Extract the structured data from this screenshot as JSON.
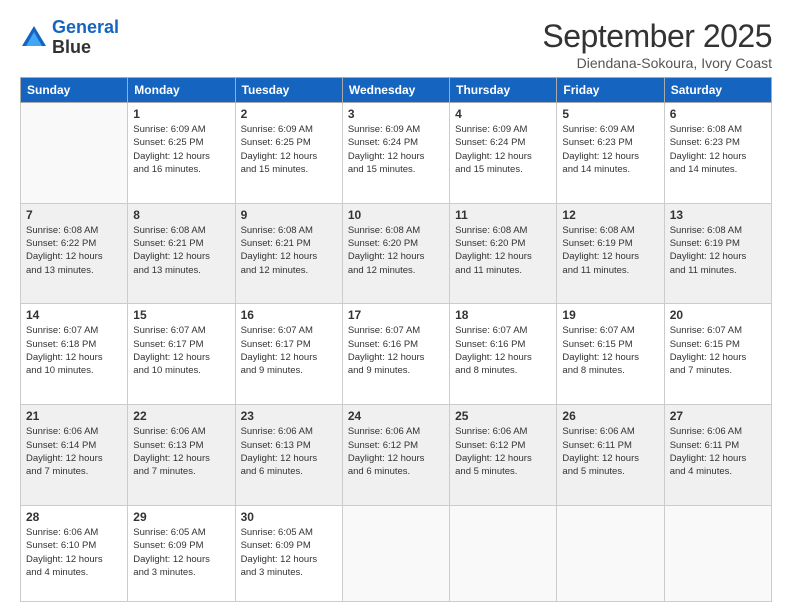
{
  "logo": {
    "line1": "General",
    "line2": "Blue"
  },
  "title": "September 2025",
  "subtitle": "Diendana-Sokoura, Ivory Coast",
  "header_days": [
    "Sunday",
    "Monday",
    "Tuesday",
    "Wednesday",
    "Thursday",
    "Friday",
    "Saturday"
  ],
  "weeks": [
    {
      "shaded": false,
      "days": [
        {
          "num": "",
          "info": ""
        },
        {
          "num": "1",
          "info": "Sunrise: 6:09 AM\nSunset: 6:25 PM\nDaylight: 12 hours\nand 16 minutes."
        },
        {
          "num": "2",
          "info": "Sunrise: 6:09 AM\nSunset: 6:25 PM\nDaylight: 12 hours\nand 15 minutes."
        },
        {
          "num": "3",
          "info": "Sunrise: 6:09 AM\nSunset: 6:24 PM\nDaylight: 12 hours\nand 15 minutes."
        },
        {
          "num": "4",
          "info": "Sunrise: 6:09 AM\nSunset: 6:24 PM\nDaylight: 12 hours\nand 15 minutes."
        },
        {
          "num": "5",
          "info": "Sunrise: 6:09 AM\nSunset: 6:23 PM\nDaylight: 12 hours\nand 14 minutes."
        },
        {
          "num": "6",
          "info": "Sunrise: 6:08 AM\nSunset: 6:23 PM\nDaylight: 12 hours\nand 14 minutes."
        }
      ]
    },
    {
      "shaded": true,
      "days": [
        {
          "num": "7",
          "info": "Sunrise: 6:08 AM\nSunset: 6:22 PM\nDaylight: 12 hours\nand 13 minutes."
        },
        {
          "num": "8",
          "info": "Sunrise: 6:08 AM\nSunset: 6:21 PM\nDaylight: 12 hours\nand 13 minutes."
        },
        {
          "num": "9",
          "info": "Sunrise: 6:08 AM\nSunset: 6:21 PM\nDaylight: 12 hours\nand 12 minutes."
        },
        {
          "num": "10",
          "info": "Sunrise: 6:08 AM\nSunset: 6:20 PM\nDaylight: 12 hours\nand 12 minutes."
        },
        {
          "num": "11",
          "info": "Sunrise: 6:08 AM\nSunset: 6:20 PM\nDaylight: 12 hours\nand 11 minutes."
        },
        {
          "num": "12",
          "info": "Sunrise: 6:08 AM\nSunset: 6:19 PM\nDaylight: 12 hours\nand 11 minutes."
        },
        {
          "num": "13",
          "info": "Sunrise: 6:08 AM\nSunset: 6:19 PM\nDaylight: 12 hours\nand 11 minutes."
        }
      ]
    },
    {
      "shaded": false,
      "days": [
        {
          "num": "14",
          "info": "Sunrise: 6:07 AM\nSunset: 6:18 PM\nDaylight: 12 hours\nand 10 minutes."
        },
        {
          "num": "15",
          "info": "Sunrise: 6:07 AM\nSunset: 6:17 PM\nDaylight: 12 hours\nand 10 minutes."
        },
        {
          "num": "16",
          "info": "Sunrise: 6:07 AM\nSunset: 6:17 PM\nDaylight: 12 hours\nand 9 minutes."
        },
        {
          "num": "17",
          "info": "Sunrise: 6:07 AM\nSunset: 6:16 PM\nDaylight: 12 hours\nand 9 minutes."
        },
        {
          "num": "18",
          "info": "Sunrise: 6:07 AM\nSunset: 6:16 PM\nDaylight: 12 hours\nand 8 minutes."
        },
        {
          "num": "19",
          "info": "Sunrise: 6:07 AM\nSunset: 6:15 PM\nDaylight: 12 hours\nand 8 minutes."
        },
        {
          "num": "20",
          "info": "Sunrise: 6:07 AM\nSunset: 6:15 PM\nDaylight: 12 hours\nand 7 minutes."
        }
      ]
    },
    {
      "shaded": true,
      "days": [
        {
          "num": "21",
          "info": "Sunrise: 6:06 AM\nSunset: 6:14 PM\nDaylight: 12 hours\nand 7 minutes."
        },
        {
          "num": "22",
          "info": "Sunrise: 6:06 AM\nSunset: 6:13 PM\nDaylight: 12 hours\nand 7 minutes."
        },
        {
          "num": "23",
          "info": "Sunrise: 6:06 AM\nSunset: 6:13 PM\nDaylight: 12 hours\nand 6 minutes."
        },
        {
          "num": "24",
          "info": "Sunrise: 6:06 AM\nSunset: 6:12 PM\nDaylight: 12 hours\nand 6 minutes."
        },
        {
          "num": "25",
          "info": "Sunrise: 6:06 AM\nSunset: 6:12 PM\nDaylight: 12 hours\nand 5 minutes."
        },
        {
          "num": "26",
          "info": "Sunrise: 6:06 AM\nSunset: 6:11 PM\nDaylight: 12 hours\nand 5 minutes."
        },
        {
          "num": "27",
          "info": "Sunrise: 6:06 AM\nSunset: 6:11 PM\nDaylight: 12 hours\nand 4 minutes."
        }
      ]
    },
    {
      "shaded": false,
      "days": [
        {
          "num": "28",
          "info": "Sunrise: 6:06 AM\nSunset: 6:10 PM\nDaylight: 12 hours\nand 4 minutes."
        },
        {
          "num": "29",
          "info": "Sunrise: 6:05 AM\nSunset: 6:09 PM\nDaylight: 12 hours\nand 3 minutes."
        },
        {
          "num": "30",
          "info": "Sunrise: 6:05 AM\nSunset: 6:09 PM\nDaylight: 12 hours\nand 3 minutes."
        },
        {
          "num": "",
          "info": ""
        },
        {
          "num": "",
          "info": ""
        },
        {
          "num": "",
          "info": ""
        },
        {
          "num": "",
          "info": ""
        }
      ]
    }
  ]
}
